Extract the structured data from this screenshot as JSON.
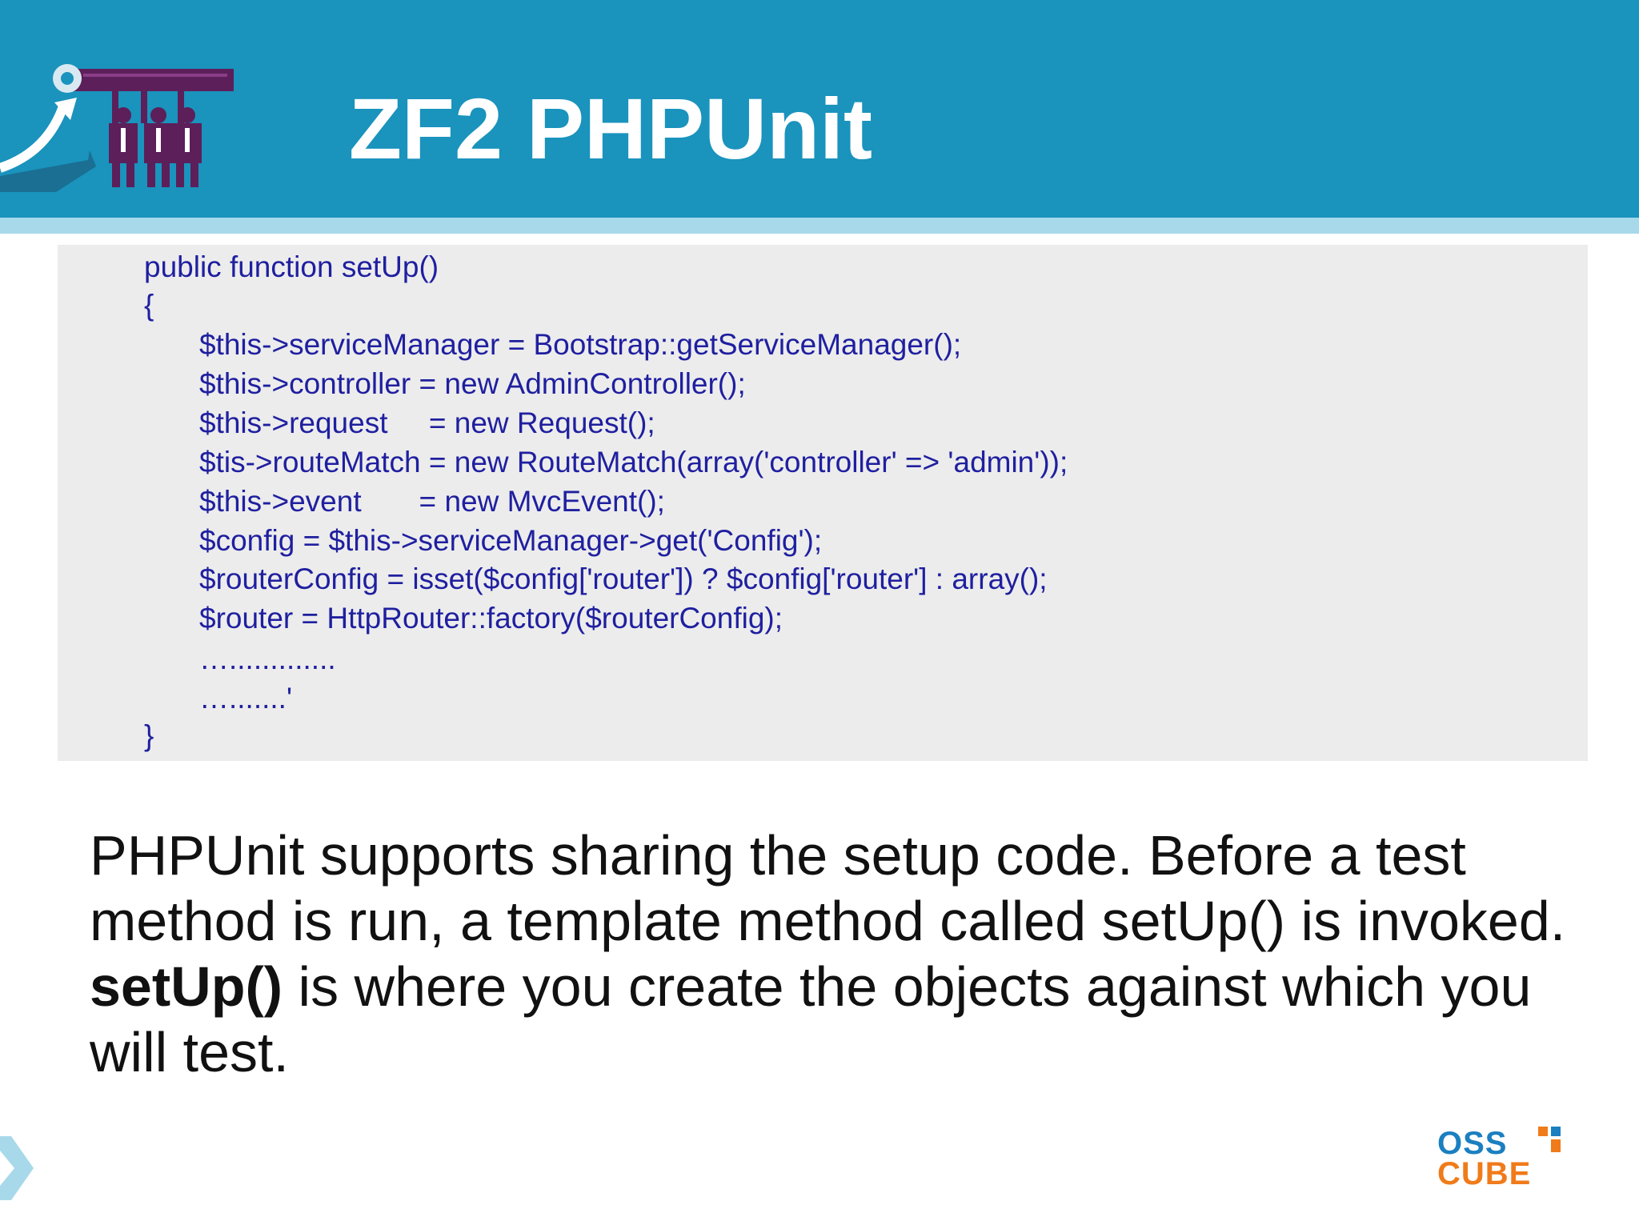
{
  "slide": {
    "title": "ZF2 PHPUnit",
    "code_lines": [
      {
        "indent": 0,
        "text": "public function setUp()"
      },
      {
        "indent": 0,
        "text": "{"
      },
      {
        "indent": 1,
        "text": "$this->serviceManager = Bootstrap::getServiceManager();"
      },
      {
        "indent": 1,
        "text": "$this->controller = new AdminController();"
      },
      {
        "indent": 1,
        "text": "$this->request     = new Request();"
      },
      {
        "indent": 1,
        "text": "$tis->routeMatch = new RouteMatch(array('controller' => 'admin'));"
      },
      {
        "indent": 1,
        "text": "$this->event       = new MvcEvent();"
      },
      {
        "indent": 1,
        "text": "$config = $this->serviceManager->get('Config');"
      },
      {
        "indent": 1,
        "text": "$routerConfig = isset($config['router']) ? $config['router'] : array();"
      },
      {
        "indent": 1,
        "text": "$router = HttpRouter::factory($routerConfig);"
      },
      {
        "indent": 1,
        "text": "…............."
      },
      {
        "indent": 1,
        "text": "….......'"
      },
      {
        "indent": 0,
        "text": "}"
      }
    ],
    "paragraph": {
      "part1": "PHPUnit supports sharing the setup code. Before a test method is run, a template method called setUp() is invoked. ",
      "bold": "setUp()",
      "part2": " is where you create the objects against which you will test."
    },
    "brand": {
      "line1": "OSS",
      "line2": "CUBE"
    },
    "colors": {
      "header_bg": "#1a93bd",
      "header_strip": "#a8d9ea",
      "code_bg": "#ececec",
      "code_text": "#1f1fa0",
      "brand_blue": "#1b7fc0",
      "brand_orange": "#f07b1a"
    }
  }
}
